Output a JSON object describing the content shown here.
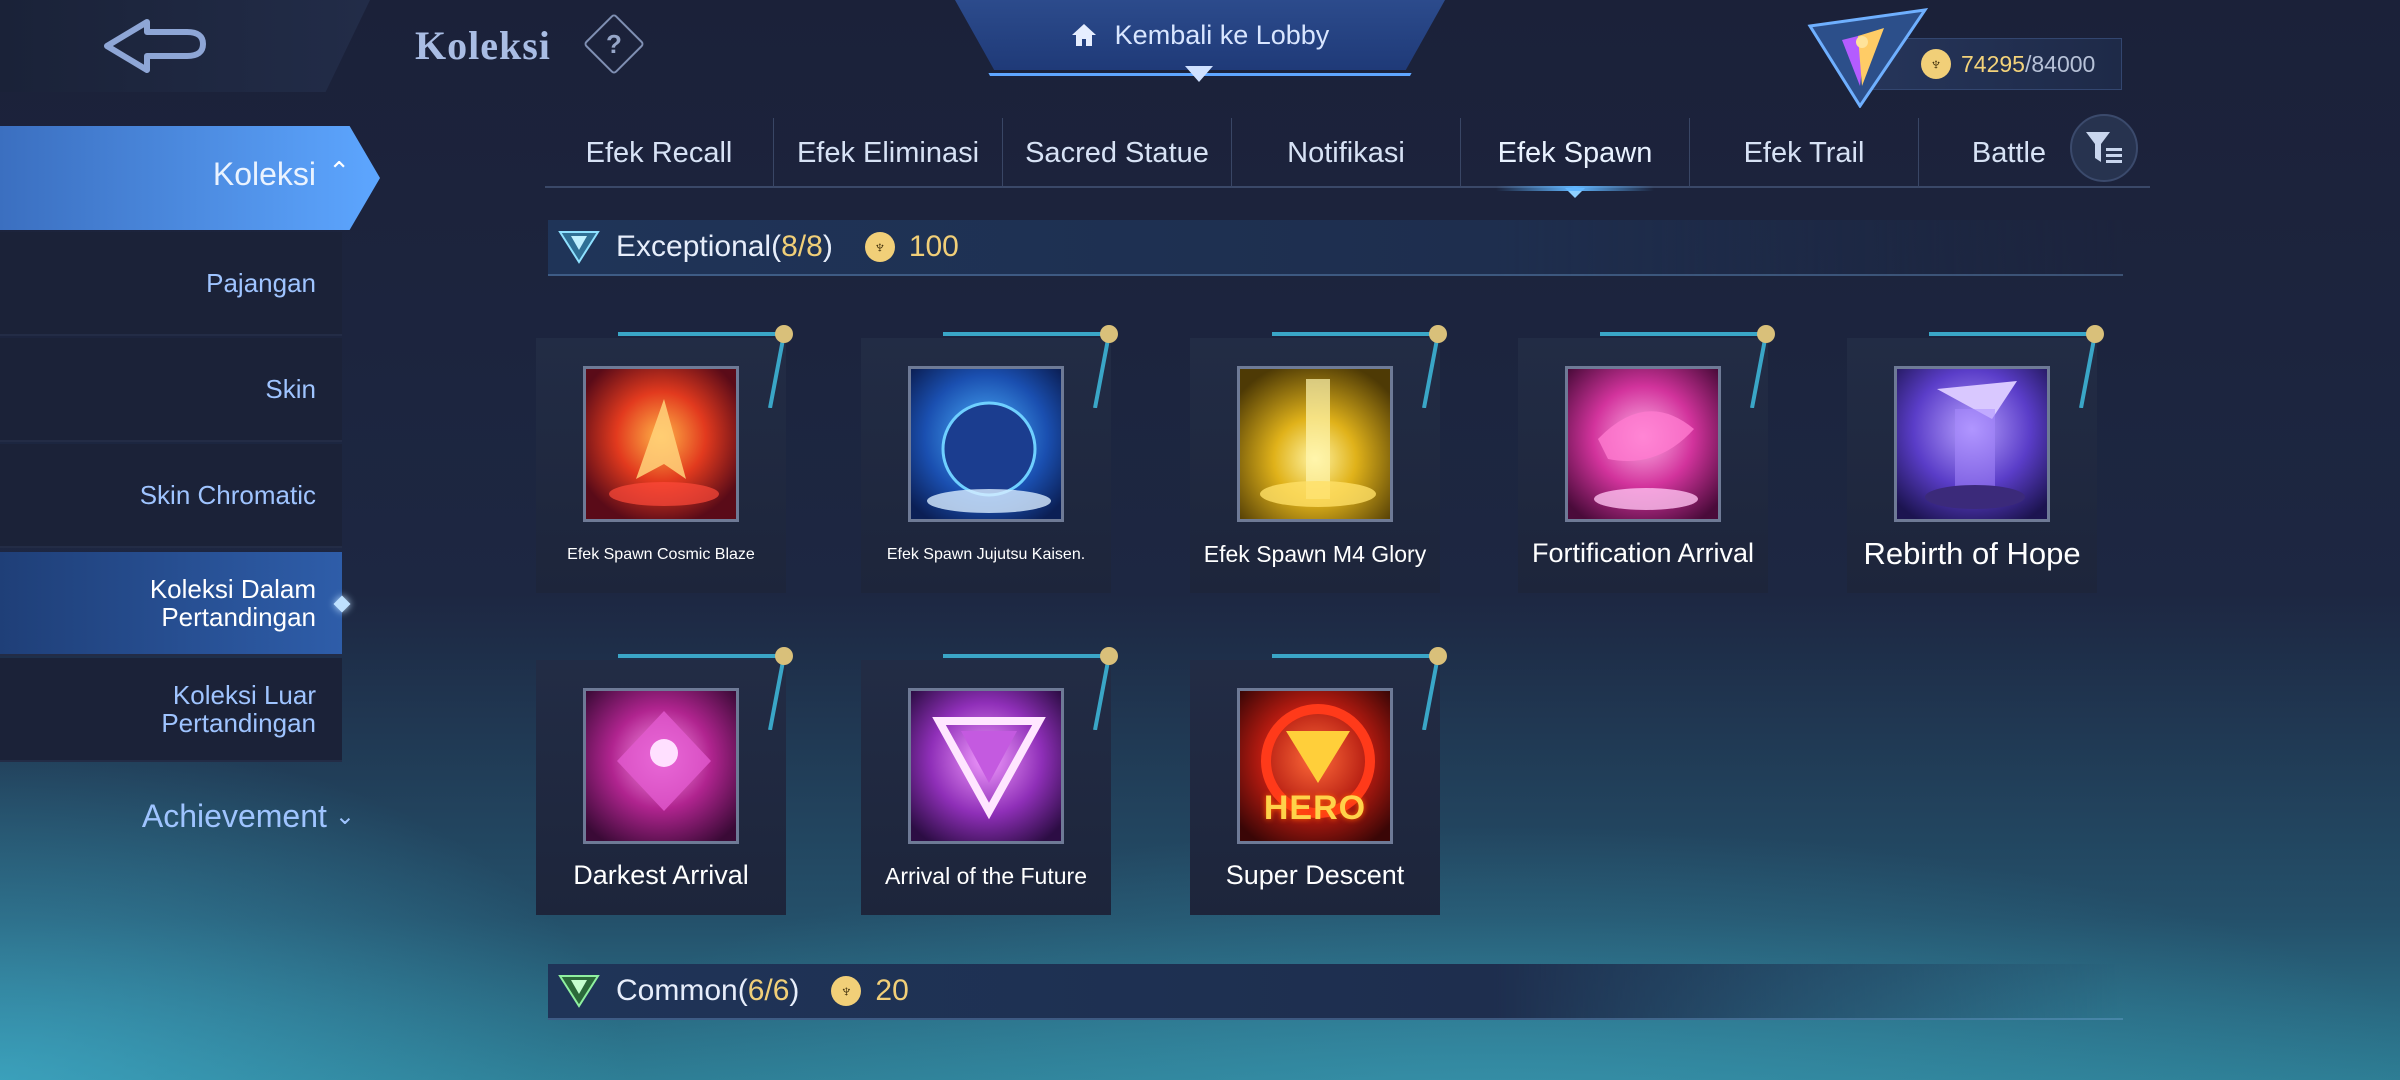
{
  "header": {
    "title": "Koleksi",
    "help_glyph": "?",
    "lobby_label": "Kembali ke Lobby",
    "currency_current": "74295",
    "currency_max": "/84000"
  },
  "sidebar": {
    "main_label": "Koleksi",
    "items": [
      {
        "label": "Pajangan"
      },
      {
        "label": "Skin"
      },
      {
        "label": "Skin Chromatic"
      },
      {
        "label": "Koleksi Dalam Pertandingan"
      },
      {
        "label": "Koleksi Luar Pertandingan"
      }
    ],
    "achievement_label": "Achievement"
  },
  "tabs": [
    {
      "label": "Efek Recall"
    },
    {
      "label": "Efek Eliminasi"
    },
    {
      "label": "Sacred Statue"
    },
    {
      "label": "Notifikasi"
    },
    {
      "label": "Efek Spawn"
    },
    {
      "label": "Efek Trail"
    },
    {
      "label": "Battle"
    }
  ],
  "active_tab": "Efek Spawn",
  "sections": [
    {
      "rank": "Exceptional(",
      "count": "8/8",
      "close": ")",
      "points": "100",
      "items": [
        {
          "name": "Efek Spawn Cosmic Blaze"
        },
        {
          "name": "Efek Spawn Jujutsu Kaisen."
        },
        {
          "name": "Efek Spawn M4 Glory"
        },
        {
          "name": "Fortification Arrival"
        },
        {
          "name": "Rebirth of Hope"
        },
        {
          "name": "Darkest Arrival"
        },
        {
          "name": "Arrival of the Future"
        },
        {
          "name": "Super Descent",
          "badge": "HERO"
        }
      ]
    },
    {
      "rank": "Common(",
      "count": "6/6",
      "close": ")",
      "points": "20"
    }
  ],
  "colors": {
    "accent_blue": "#5da6ff",
    "gold": "#f1cf78",
    "background": "#1d2742"
  }
}
